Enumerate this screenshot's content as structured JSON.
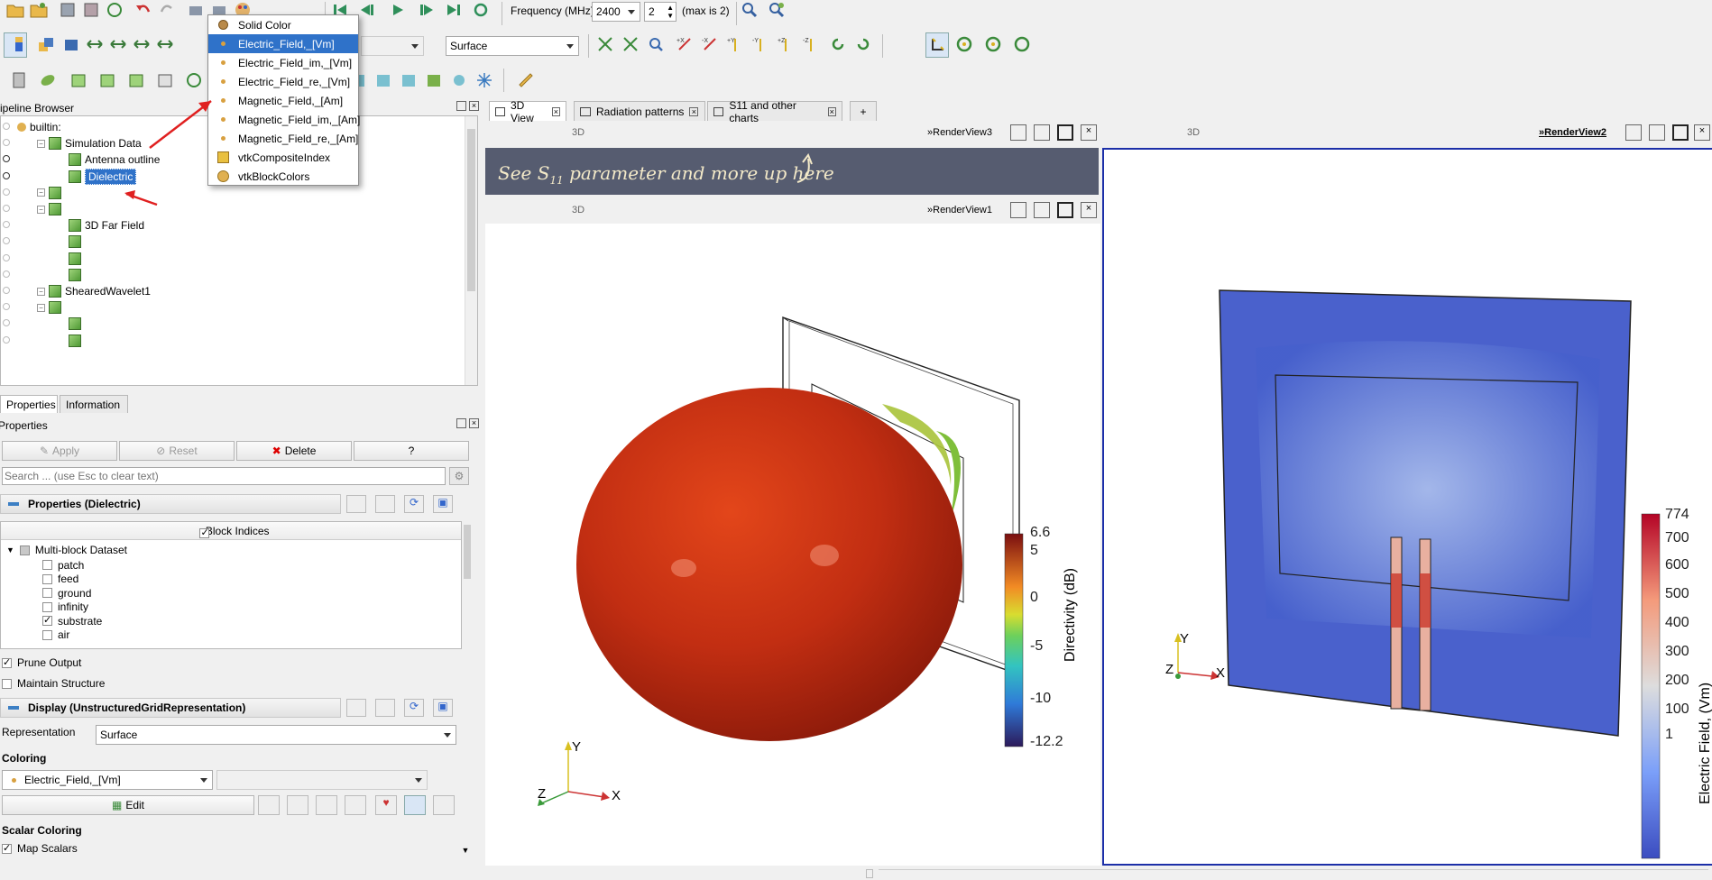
{
  "toolbar1": {
    "frequency_label": "Frequency (MHz):",
    "frequency_value": "2400",
    "step_value": "2",
    "max_text": "(max is 2)"
  },
  "toolbar2": {
    "representation_value": "Surface"
  },
  "color_menu": {
    "items": [
      {
        "label": "Solid Color",
        "icon": "solid-color-icon",
        "selected": false
      },
      {
        "label": "Electric_Field,_[Vm]",
        "icon": "point-data-icon",
        "selected": true
      },
      {
        "label": "Electric_Field_im,_[Vm]",
        "icon": "point-data-icon",
        "selected": false
      },
      {
        "label": "Electric_Field_re,_[Vm]",
        "icon": "point-data-icon",
        "selected": false
      },
      {
        "label": "Magnetic_Field,_[Am]",
        "icon": "point-data-icon",
        "selected": false
      },
      {
        "label": "Magnetic_Field_im,_[Am]",
        "icon": "point-data-icon",
        "selected": false
      },
      {
        "label": "Magnetic_Field_re,_[Am]",
        "icon": "point-data-icon",
        "selected": false
      },
      {
        "label": "vtkCompositeIndex",
        "icon": "composite-index-icon",
        "selected": false
      },
      {
        "label": "vtkBlockColors",
        "icon": "block-colors-icon",
        "selected": false
      }
    ]
  },
  "pipeline": {
    "title": "Pipeline Browser",
    "items": [
      {
        "label": "builtin:",
        "indent": 0,
        "cube": false
      },
      {
        "label": "Simulation Data",
        "indent": 1,
        "cube": true
      },
      {
        "label": "Antenna outline",
        "indent": 2,
        "cube": true
      },
      {
        "label": "Dielectric",
        "indent": 2,
        "cube": true,
        "selected": true
      },
      {
        "label": "",
        "indent": 1,
        "cube": true
      },
      {
        "label": "",
        "indent": 1,
        "cube": true
      },
      {
        "label": "3D Far Field",
        "indent": 2,
        "cube": true
      },
      {
        "label": "",
        "indent": 2,
        "cube": true
      },
      {
        "label": "",
        "indent": 2,
        "cube": true
      },
      {
        "label": "",
        "indent": 2,
        "cube": true
      },
      {
        "label": "ShearedWavelet1",
        "indent": 1,
        "cube": true
      },
      {
        "label": "",
        "indent": 1,
        "cube": true
      },
      {
        "label": "",
        "indent": 2,
        "cube": true
      },
      {
        "label": "",
        "indent": 2,
        "cube": true
      }
    ]
  },
  "props_tabs": {
    "properties": "Properties",
    "information": "Information"
  },
  "properties": {
    "title": "Properties",
    "apply": "Apply",
    "reset": "Reset",
    "delete": "Delete",
    "help": "?",
    "search_placeholder": "Search ... (use Esc to clear text)",
    "section_props": "Properties (Dielectric)",
    "block_indices": "Block Indices",
    "dataset_label": "Multi-block Dataset",
    "blocks": [
      {
        "label": "patch",
        "checked": false
      },
      {
        "label": "feed",
        "checked": false
      },
      {
        "label": "ground",
        "checked": false
      },
      {
        "label": "infinity",
        "checked": false
      },
      {
        "label": "substrate",
        "checked": true
      },
      {
        "label": "air",
        "checked": false
      }
    ],
    "prune_output": "Prune Output",
    "maintain_structure": "Maintain Structure",
    "section_display": "Display (UnstructuredGridRepresentation)",
    "representation_label": "Representation",
    "representation_value": "Surface",
    "coloring_label": "Coloring",
    "coloring_value": "Electric_Field,_[Vm]",
    "edit": "Edit",
    "scalar_coloring_label": "Scalar Coloring",
    "map_scalars": "Map Scalars"
  },
  "tabs": {
    "t1": "3D View",
    "t2": "Radiation patterns",
    "t3": "S11 and other charts",
    "add": "+"
  },
  "views": {
    "rv3": "RenderView3",
    "rv1": "RenderView1",
    "rv2": "RenderView2",
    "mode3d": "3D",
    "banner_text": "See S",
    "banner_sub": "11",
    "banner_rest": " parameter and more up here"
  },
  "legend_left": {
    "title": "Directivity (dB)",
    "labels": [
      "6.6",
      "5",
      "0",
      "-5",
      "-10",
      "-12.2"
    ]
  },
  "legend_right": {
    "title": "Electric Field, (Vm)",
    "labels": [
      "774",
      "700",
      "600",
      "500",
      "400",
      "300",
      "200",
      "100",
      "1"
    ]
  },
  "axes": {
    "x": "X",
    "y": "Y",
    "z": "Z"
  }
}
